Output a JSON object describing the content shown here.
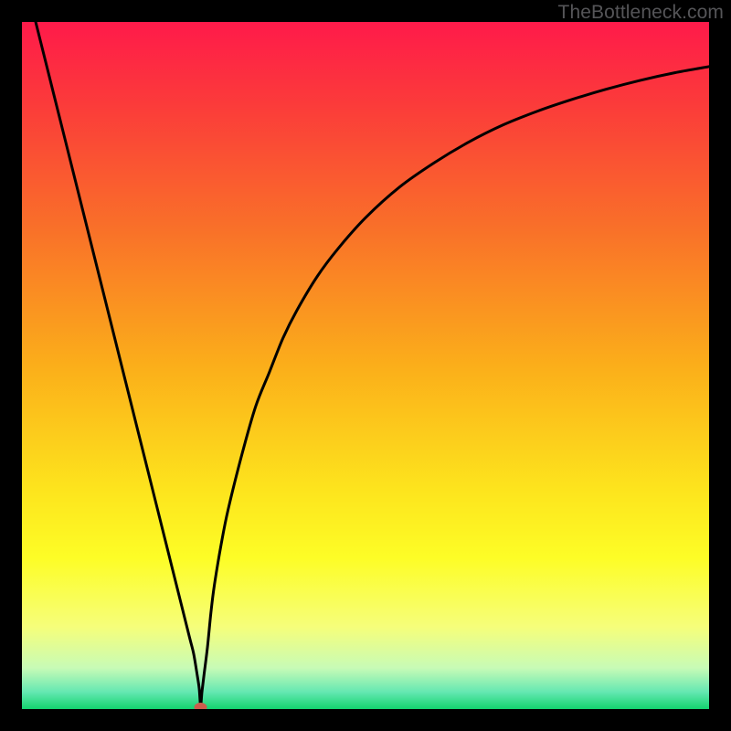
{
  "attribution": "TheBottleneck.com",
  "chart_data": {
    "type": "line",
    "title": "",
    "xlabel": "",
    "ylabel": "",
    "xlim": [
      0,
      100
    ],
    "ylim": [
      0,
      100
    ],
    "legend": false,
    "grid": false,
    "background": {
      "type": "vertical-gradient",
      "stops": [
        {
          "offset": 0.0,
          "color": "#ff1a4a"
        },
        {
          "offset": 0.12,
          "color": "#fb3b3a"
        },
        {
          "offset": 0.3,
          "color": "#f97029"
        },
        {
          "offset": 0.5,
          "color": "#fbae1a"
        },
        {
          "offset": 0.68,
          "color": "#fde41d"
        },
        {
          "offset": 0.78,
          "color": "#fdfd26"
        },
        {
          "offset": 0.88,
          "color": "#f6fe7a"
        },
        {
          "offset": 0.94,
          "color": "#c8fbb6"
        },
        {
          "offset": 0.975,
          "color": "#65e8b2"
        },
        {
          "offset": 1.0,
          "color": "#13d36e"
        }
      ]
    },
    "marker": {
      "x": 26,
      "y": 0,
      "color": "#cd5d4c"
    },
    "series": [
      {
        "name": "bottleneck-curve",
        "color": "#000000",
        "x": [
          0,
          2,
          4,
          6,
          8,
          10,
          12,
          14,
          16,
          18,
          20,
          21,
          22,
          23,
          24,
          24.5,
          25,
          25.5,
          25.8,
          26,
          26.2,
          26.5,
          27,
          27.5,
          28,
          29,
          30,
          32,
          34,
          36,
          38,
          40,
          43,
          46,
          50,
          55,
          60,
          65,
          70,
          75,
          80,
          85,
          90,
          95,
          100
        ],
        "values": [
          108,
          100,
          92,
          84,
          76,
          68,
          60,
          52,
          44,
          36,
          28,
          24,
          20,
          16,
          12,
          10,
          8,
          5,
          3,
          0.5,
          2.5,
          5,
          9,
          14,
          18,
          24,
          29,
          37,
          44,
          49,
          54,
          58,
          63,
          67,
          71.5,
          76,
          79.5,
          82.5,
          85,
          87,
          88.7,
          90.2,
          91.5,
          92.6,
          93.5
        ]
      }
    ]
  }
}
